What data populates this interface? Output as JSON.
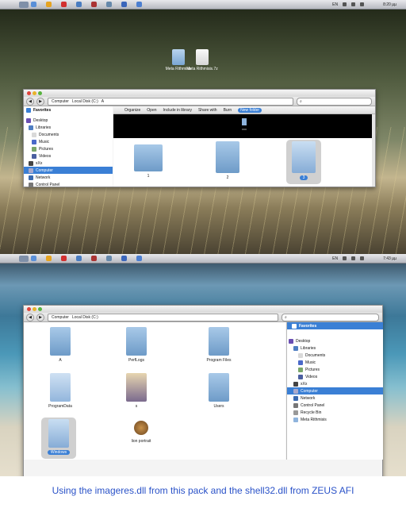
{
  "top": {
    "taskbar": {
      "lang": "EN",
      "clock": "8:20 µµ"
    },
    "desktop_icons": [
      {
        "label": "Meta Rithmisis"
      },
      {
        "label": "Meta Rithmisis.7z"
      }
    ],
    "window": {
      "breadcrumb": [
        "Computer",
        "Local Disk (C:)",
        "A"
      ],
      "sidebar": {
        "favorites": "Favorites",
        "items": [
          "Desktop",
          "Libraries",
          "Documents",
          "Music",
          "Pictures",
          "Videos",
          "xXx",
          "Computer",
          "Network",
          "Control Panel"
        ]
      },
      "toolbar": [
        "Organize",
        "Open",
        "Include in library",
        "Share with",
        "Burn"
      ],
      "new_folder": "New folder",
      "preview_label": "xxx",
      "folders": [
        "1",
        "2",
        "3"
      ]
    }
  },
  "bottom": {
    "taskbar": {
      "lang": "EN",
      "clock": "7:43 µµ"
    },
    "window": {
      "breadcrumb": [
        "Computer",
        "Local Disk (C:)"
      ],
      "folders": [
        "A",
        "PerfLogs",
        "Program Files",
        "ProgramData",
        "s",
        "Users",
        "Windows",
        "lion portrait"
      ],
      "sidebar": {
        "favorites": "Favorites",
        "items": [
          "Desktop",
          "Libraries",
          "Documents",
          "Music",
          "Pictures",
          "Videos",
          "xXx",
          "Computer",
          "Network",
          "Control Panel",
          "Recycle Bin",
          "Meta Rithmisis"
        ]
      }
    }
  },
  "caption": "Using the imageres.dll from this pack and the shell32.dll from ZEUS AFI",
  "colors": {
    "accent": "#3a7fd5",
    "caption": "#2a52c8"
  }
}
